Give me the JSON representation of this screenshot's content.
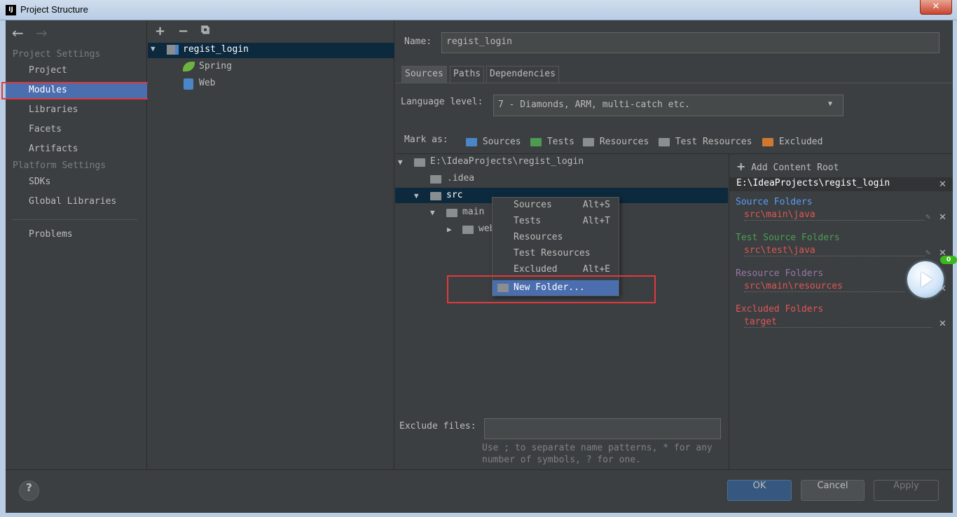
{
  "window": {
    "title": "Project Structure",
    "app_icon": "IJ",
    "close_glyph": "✕"
  },
  "nav": {
    "back_arrow": "←",
    "forward_arrow": "→",
    "project_settings_header": "Project Settings",
    "items_project": [
      "Project",
      "Modules",
      "Libraries",
      "Facets",
      "Artifacts"
    ],
    "platform_settings_header": "Platform Settings",
    "items_platform": [
      "SDKs",
      "Global Libraries"
    ],
    "problems": "Problems",
    "selected": "Modules"
  },
  "module_tree": {
    "toolbar": {
      "add": "+",
      "remove": "−",
      "copy": "⧉"
    },
    "root": "regist_login",
    "children": [
      "Spring",
      "Web"
    ]
  },
  "details": {
    "name_label": "Name:",
    "name_value": "regist_login",
    "tabs": [
      "Sources",
      "Paths",
      "Dependencies"
    ],
    "active_tab": "Sources",
    "language_level_label": "Language level:",
    "language_level_value": "7 - Diamonds, ARM, multi-catch etc.",
    "mark_as_label": "Mark as:",
    "mark_as": [
      {
        "label": "Sources",
        "color": "#4a86c8"
      },
      {
        "label": "Tests",
        "color": "#4e9a50"
      },
      {
        "label": "Resources",
        "color": "#8b8e90"
      },
      {
        "label": "Test Resources",
        "color": "#8b8e90"
      },
      {
        "label": "Excluded",
        "color": "#d0782f"
      }
    ],
    "tree": {
      "root": "E:\\IdeaProjects\\regist_login",
      "idea": ".idea",
      "src": "src",
      "main": "main",
      "web": "web"
    },
    "exclude_files_label": "Exclude files:",
    "exclude_files_value": "",
    "exclude_hint": "Use ; to separate name patterns, * for any number of symbols, ? for one."
  },
  "content_root": {
    "add_label": "Add Content Root",
    "root_path": "E:\\IdeaProjects\\regist_login",
    "source_folders_label": "Source Folders",
    "source_folders": [
      "src\\main\\java"
    ],
    "test_source_folders_label": "Test Source Folders",
    "test_source_folders": [
      "src\\test\\java"
    ],
    "resource_folders_label": "Resource Folders",
    "resource_folders": [
      "src\\main\\resources"
    ],
    "excluded_folders_label": "Excluded Folders",
    "excluded_folders": [
      "target"
    ],
    "colors": {
      "source": "#589df6",
      "test": "#499c54",
      "resource": "#9876aa",
      "excluded": "#e05555"
    }
  },
  "context_menu": {
    "items": [
      {
        "label": "Sources",
        "shortcut": "Alt+S"
      },
      {
        "label": "Tests",
        "shortcut": "Alt+T"
      },
      {
        "label": "Resources",
        "shortcut": ""
      },
      {
        "label": "Test Resources",
        "shortcut": ""
      },
      {
        "label": "Excluded",
        "shortcut": "Alt+E"
      }
    ],
    "new_folder": "New Folder..."
  },
  "buttons": {
    "help": "?",
    "ok": "OK",
    "cancel": "Cancel",
    "apply": "Apply"
  },
  "overlay": {
    "badge": "0"
  }
}
